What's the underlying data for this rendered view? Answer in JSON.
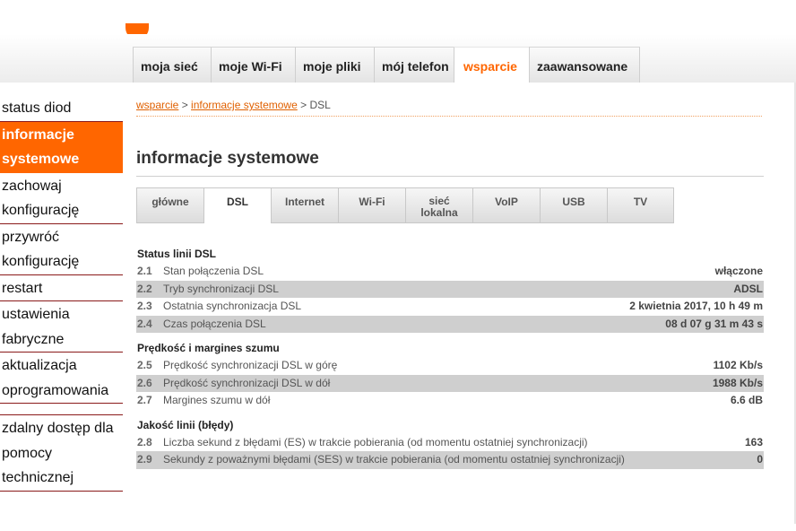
{
  "top_nav": {
    "tabs": [
      {
        "label": "moja sieć"
      },
      {
        "label": "moje Wi-Fi"
      },
      {
        "label": "moje pliki"
      },
      {
        "label": "mój telefon"
      },
      {
        "label": "wsparcie",
        "active": true
      },
      {
        "label": "zaawansowane"
      }
    ]
  },
  "sidebar": {
    "items": [
      {
        "label": "status diod"
      },
      {
        "label": "informacje systemowe",
        "active": true
      },
      {
        "label": "zachowaj konfigurację"
      },
      {
        "label": "przywróć konfigurację"
      },
      {
        "label": "restart"
      },
      {
        "label": "ustawienia fabryczne"
      },
      {
        "label": "aktualizacja oprogramowania"
      },
      {
        "label": "zdalny dostęp dla pomocy technicznej"
      }
    ]
  },
  "breadcrumb": {
    "item1": "wsparcie",
    "sep1": " > ",
    "item2": "informacje systemowe",
    "sep2": " > ",
    "current": "DSL"
  },
  "page_title": "informacje systemowe",
  "sub_tabs": [
    {
      "label": "główne"
    },
    {
      "label": "DSL",
      "active": true
    },
    {
      "label": "Internet"
    },
    {
      "label": "Wi-Fi"
    },
    {
      "label": "sieć lokalna"
    },
    {
      "label": "VoIP"
    },
    {
      "label": "USB"
    },
    {
      "label": "TV"
    }
  ],
  "sections": [
    {
      "title": "Status linii DSL",
      "rows": [
        {
          "num": "2.1",
          "label": "Stan połączenia DSL",
          "value": "włączone"
        },
        {
          "num": "2.2",
          "label": "Tryb synchronizacji DSL",
          "value": "ADSL"
        },
        {
          "num": "2.3",
          "label": "Ostatnia synchronizacja DSL",
          "value": "2 kwietnia 2017, 10 h 49 m"
        },
        {
          "num": "2.4",
          "label": "Czas połączenia DSL",
          "value": "08 d 07 g 31 m 43 s"
        }
      ]
    },
    {
      "title": "Prędkość i margines szumu",
      "rows": [
        {
          "num": "2.5",
          "label": "Prędkość synchronizacji DSL w górę",
          "value": "1102 Kb/s"
        },
        {
          "num": "2.6",
          "label": "Prędkość synchronizacji DSL w dół",
          "value": "1988 Kb/s"
        },
        {
          "num": "2.7",
          "label": "Margines szumu w dół",
          "value": "6.6 dB"
        }
      ]
    },
    {
      "title": "Jakość linii (błędy)",
      "rows": [
        {
          "num": "2.8",
          "label": "Liczba sekund z błędami (ES) w trakcie pobierania (od momentu ostatniej synchronizacji)",
          "value": "163"
        },
        {
          "num": "2.9",
          "label": "Sekundy z poważnymi błędami (SES) w trakcie pobierania (od momentu ostatniej synchronizacji)",
          "value": "0"
        }
      ]
    }
  ],
  "colors": {
    "accent": "#ff6600",
    "row_shade": "#cfcfcf",
    "link": "#e06000"
  }
}
